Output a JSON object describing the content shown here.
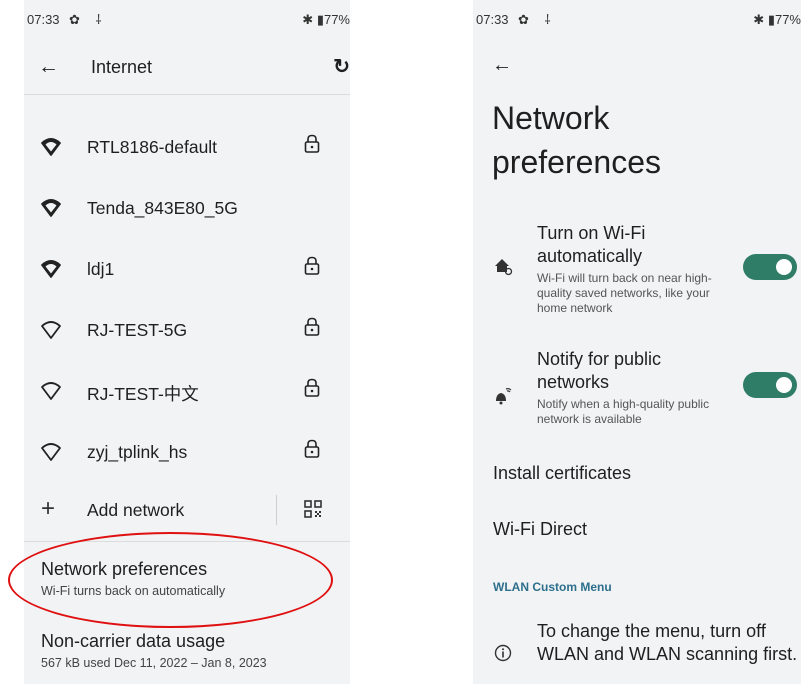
{
  "left": {
    "status": {
      "time": "07:33",
      "battery": "77%"
    },
    "appbar": {
      "title": "Internet"
    },
    "networks": [
      {
        "ssid": "RTL8186-default",
        "locked": true,
        "signal": "full"
      },
      {
        "ssid": "Tenda_843E80_5G",
        "locked": false,
        "signal": "full"
      },
      {
        "ssid": "ldj1",
        "locked": true,
        "signal": "full"
      },
      {
        "ssid": "RJ-TEST-5G",
        "locked": true,
        "signal": "outline"
      },
      {
        "ssid": "RJ-TEST-中文",
        "locked": true,
        "signal": "outline"
      },
      {
        "ssid": "zyj_tplink_hs",
        "locked": true,
        "signal": "outline"
      }
    ],
    "add_network": "Add network",
    "network_preferences": {
      "title": "Network preferences",
      "subtitle": "Wi-Fi turns back on automatically"
    },
    "data_usage": {
      "title": "Non-carrier data usage",
      "subtitle": "567 kB used Dec 11, 2022 – Jan 8, 2023"
    },
    "annotation_color": "#e01010"
  },
  "right": {
    "status": {
      "time": "07:33",
      "battery": "77%"
    },
    "title_line1": "Network",
    "title_line2": "preferences",
    "wifi_auto": {
      "title": "Turn on Wi-Fi automatically",
      "subtitle": "Wi-Fi will turn back on near high-quality saved networks, like your home network",
      "on": true
    },
    "notify_public": {
      "title": "Notify for public networks",
      "subtitle": "Notify when a high-quality public network is available",
      "on": true
    },
    "install_certificates": "Install certificates",
    "wifi_direct": "Wi-Fi Direct",
    "section_header": "WLAN Custom Menu",
    "info_text": "To change the menu, turn off WLAN and WLAN scanning first.",
    "accent_color": "#2f7d67"
  }
}
